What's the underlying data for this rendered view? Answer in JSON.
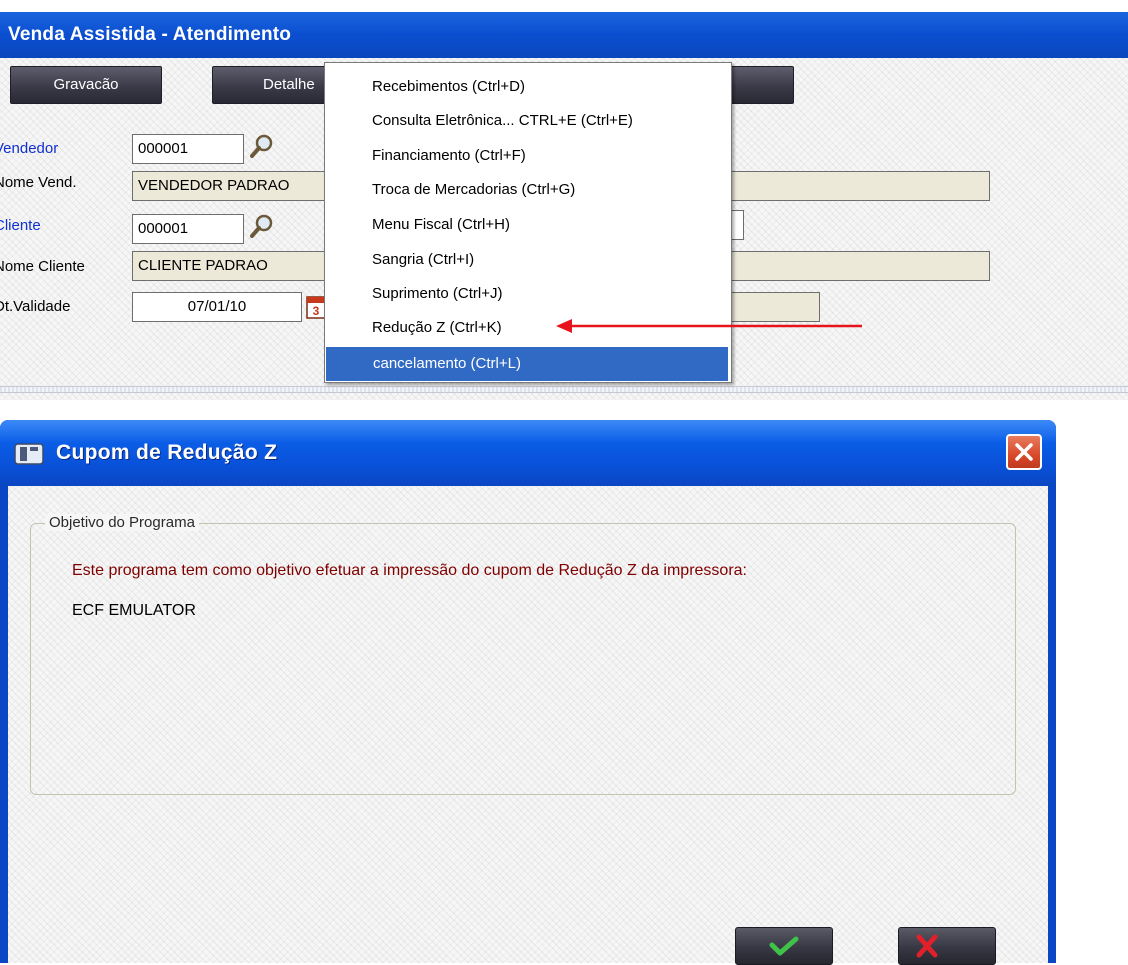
{
  "top_window": {
    "title": "Venda Assistida - Atendimento",
    "toolbar": {
      "gravacao_label": "Gravacão",
      "detalhes_label": "Detalhe"
    },
    "form": {
      "vendedor_label": "Vendedor",
      "vendedor_value": "000001",
      "nome_vend_label": "Nome Vend.",
      "nome_vend_value": "VENDEDOR PADRAO",
      "cliente_label": "Cliente",
      "cliente_value": "000001",
      "nome_cliente_label": "Nome Cliente",
      "nome_cliente_value": "CLIENTE PADRAO",
      "validade_label": "Dt.Validade",
      "validade_value": "07/01/10"
    }
  },
  "menu": {
    "items": [
      {
        "label": "Recebimentos (Ctrl+D)"
      },
      {
        "label": "Consulta Eletrônica... CTRL+E (Ctrl+E)"
      },
      {
        "label": "Financiamento (Ctrl+F)"
      },
      {
        "label": "Troca de Mercadorias (Ctrl+G)"
      },
      {
        "label": "Menu Fiscal (Ctrl+H)"
      },
      {
        "label": "Sangria (Ctrl+I)"
      },
      {
        "label": "Suprimento (Ctrl+J)"
      },
      {
        "label": "Redução Z (Ctrl+K)"
      },
      {
        "label": "cancelamento (Ctrl+L)"
      }
    ],
    "selected_index": 8
  },
  "annotation": {
    "arrow_color": "#e8141b"
  },
  "dialog": {
    "title": "Cupom de Redução Z",
    "group_label": "Objetivo do Programa",
    "description": "Este programa tem como  objetivo  efetuar a  impressão do cupom de Redução Z da impressora:",
    "printer": "ECF EMULATOR",
    "ok_icon": "check-icon",
    "cancel_icon": "x-icon"
  },
  "colors": {
    "title_bar": "#0b4fd0",
    "menu_highlight": "#316ac5",
    "description_text": "#800000",
    "link_label": "#1030d0"
  }
}
